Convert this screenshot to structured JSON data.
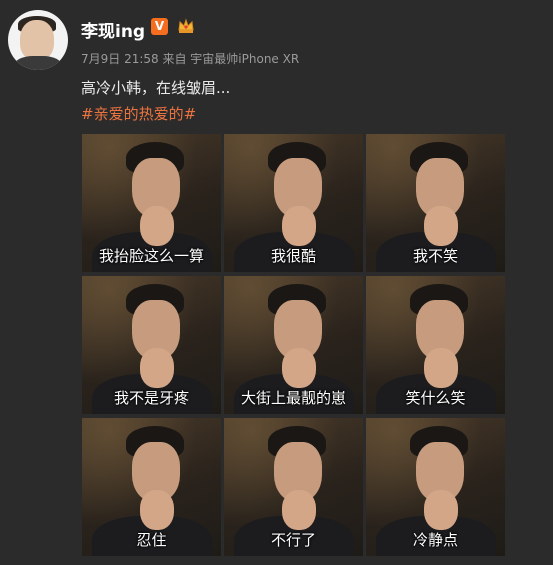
{
  "post": {
    "username": "李现ing",
    "verified_badge": "V",
    "meta": "7月9日 21:58 来自 宇宙最帅iPhone XR",
    "content": "高冷小韩，在线皱眉...",
    "topic": "#亲爱的热爱的#"
  },
  "icons": {
    "avatar": "avatar-image",
    "verified": "verified-v-icon",
    "crown": "crown-badge-icon"
  },
  "colors": {
    "background": "#2b2b2b",
    "topic": "#eb7340",
    "verified_badge": "#f56e1f"
  },
  "images": [
    {
      "caption": "我抬脸这么一算"
    },
    {
      "caption": "我很酷"
    },
    {
      "caption": "我不笑"
    },
    {
      "caption": "我不是牙疼"
    },
    {
      "caption": "大街上最靓的崽"
    },
    {
      "caption": "笑什么笑"
    },
    {
      "caption": "忍住"
    },
    {
      "caption": "不行了"
    },
    {
      "caption": "冷静点"
    }
  ]
}
